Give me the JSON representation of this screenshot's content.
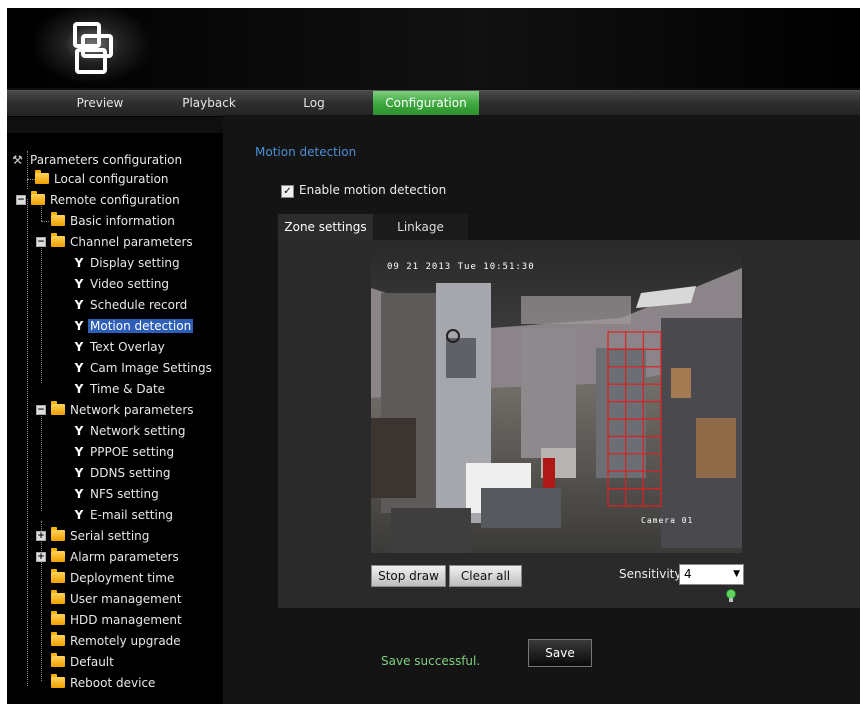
{
  "nav": {
    "tabs": [
      {
        "label": "Preview"
      },
      {
        "label": "Playback"
      },
      {
        "label": "Log"
      },
      {
        "label": "Configuration",
        "active": true
      }
    ]
  },
  "tree": {
    "root": "Parameters configuration",
    "items": [
      {
        "label": "Local configuration",
        "type": "folder"
      },
      {
        "label": "Remote configuration",
        "type": "folder",
        "expanded": true
      },
      {
        "label": "Basic information",
        "type": "folder"
      },
      {
        "label": "Channel parameters",
        "type": "folder",
        "expanded": true
      },
      {
        "label": "Display setting",
        "type": "leaf"
      },
      {
        "label": "Video setting",
        "type": "leaf"
      },
      {
        "label": "Schedule record",
        "type": "leaf"
      },
      {
        "label": "Motion detection",
        "type": "leaf",
        "selected": true
      },
      {
        "label": "Text Overlay",
        "type": "leaf"
      },
      {
        "label": "Cam Image Settings",
        "type": "leaf"
      },
      {
        "label": "Time & Date",
        "type": "leaf"
      },
      {
        "label": "Network parameters",
        "type": "folder",
        "expanded": true
      },
      {
        "label": "Network setting",
        "type": "leaf"
      },
      {
        "label": "PPPOE setting",
        "type": "leaf"
      },
      {
        "label": "DDNS setting",
        "type": "leaf"
      },
      {
        "label": "NFS setting",
        "type": "leaf"
      },
      {
        "label": "E-mail setting",
        "type": "leaf"
      },
      {
        "label": "Serial setting",
        "type": "folder",
        "expanded": false
      },
      {
        "label": "Alarm parameters",
        "type": "folder",
        "expanded": false
      },
      {
        "label": "Deployment time",
        "type": "folder"
      },
      {
        "label": "User management",
        "type": "folder"
      },
      {
        "label": "HDD management",
        "type": "folder"
      },
      {
        "label": "Remotely upgrade",
        "type": "folder"
      },
      {
        "label": "Default",
        "type": "folder"
      },
      {
        "label": "Reboot device",
        "type": "folder"
      }
    ]
  },
  "main": {
    "title": "Motion detection",
    "enable_label": "Enable motion detection",
    "enable_checked": true,
    "subtabs": [
      {
        "label": "Zone settings",
        "active": true
      },
      {
        "label": "Linkage"
      }
    ],
    "video": {
      "timestamp": "09 21 2013 Tue 10:51:30",
      "camera_label": "Camera 01"
    },
    "stop_draw_label": "Stop draw",
    "clear_all_label": "Clear all",
    "sensitivity_label": "Sensitivity:",
    "sensitivity_value": "4",
    "status": "Save successful.",
    "save_label": "Save"
  },
  "colors": {
    "accent": "#3aa53a",
    "selected": "#2d5fb8",
    "title": "#4a8fd6",
    "status": "#7fd07f",
    "grid": "#e02020"
  }
}
